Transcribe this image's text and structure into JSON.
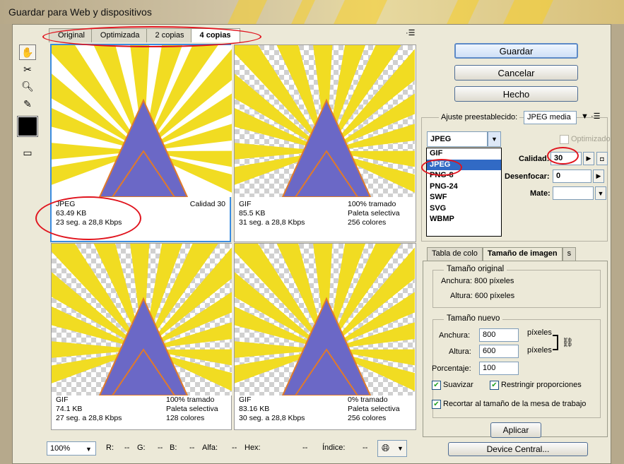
{
  "window": {
    "title": "Guardar para Web y dispositivos"
  },
  "tools": [
    "hand-icon",
    "slice-select-icon",
    "zoom-icon",
    "eyedropper-icon"
  ],
  "view_tabs": [
    {
      "label": "Original",
      "selected": false
    },
    {
      "label": "Optimizada",
      "selected": false
    },
    {
      "label": "2 copias",
      "selected": false
    },
    {
      "label": "4 copias",
      "selected": true
    }
  ],
  "tabs_menu_icon": "menu-icon",
  "panes": [
    {
      "format": "JPEG",
      "size": "63.49 KB",
      "time": "23 seg. a 28,8 Kbps",
      "right1": "Calidad 30",
      "right2": "",
      "right3": ""
    },
    {
      "format": "GIF",
      "size": "85.5 KB",
      "time": "31 seg. a 28,8 Kbps",
      "right1": "100% tramado",
      "right2": "Paleta selectiva",
      "right3": "256 colores"
    },
    {
      "format": "GIF",
      "size": "74.1 KB",
      "time": "27 seg. a 28,8 Kbps",
      "right1": "100% tramado",
      "right2": "Paleta selectiva",
      "right3": "128 colores"
    },
    {
      "format": "GIF",
      "size": "83.16 KB",
      "time": "30 seg. a 28,8 Kbps",
      "right1": "0% tramado",
      "right2": "Paleta selectiva",
      "right3": "256 colores"
    }
  ],
  "buttons": {
    "save": "Guardar",
    "cancel": "Cancelar",
    "done": "Hecho",
    "apply": "Aplicar",
    "device_central": "Device Central..."
  },
  "preset": {
    "label": "Ajuste preestablecido:",
    "value": "JPEG media"
  },
  "format": {
    "value": "JPEG",
    "options": [
      "GIF",
      "JPEG",
      "PNG-8",
      "PNG-24",
      "SWF",
      "SVG",
      "WBMP"
    ],
    "selected_index": 1
  },
  "optimized": {
    "label": "Optimizado",
    "checked": false
  },
  "quality": {
    "label": "Calidad:",
    "value": "30"
  },
  "blur": {
    "label": "Desenfocar:",
    "value": "0"
  },
  "matte": {
    "label": "Mate:",
    "value": ""
  },
  "right_tabs": [
    {
      "label": "Tabla de colo",
      "selected": false
    },
    {
      "label": "Tamaño de imagen",
      "selected": true
    },
    {
      "label": "s",
      "selected": false
    }
  ],
  "original_size": {
    "title": "Tamaño original",
    "width": "Anchura: 800 píxeles",
    "height": "Altura: 600 píxeles"
  },
  "new_size": {
    "title": "Tamaño nuevo",
    "width_label": "Anchura:",
    "width_value": "800",
    "width_unit": "píxeles",
    "height_label": "Altura:",
    "height_value": "600",
    "height_unit": "píxeles",
    "percent_label": "Porcentaje:",
    "percent_value": "100",
    "smooth_label": "Suavizar",
    "smooth_checked": true,
    "constrain_label": "Restringir proporciones",
    "constrain_checked": true,
    "crop_label": "Recortar al tamaño de la mesa de trabajo",
    "crop_checked": true
  },
  "status": {
    "zoom": "100%",
    "r_label": "R:",
    "r_value": "--",
    "g_label": "G:",
    "g_value": "--",
    "b_label": "B:",
    "b_value": "--",
    "alpha_label": "Alfa:",
    "alpha_value": "--",
    "hex_label": "Hex:",
    "hex_value": "--",
    "index_label": "Índice:",
    "index_value": "--"
  },
  "colors": {
    "yellow": "#f1dc22",
    "triangle": "#6b68c6",
    "outline": "#e07a2a",
    "accent_selected": "#3b8ce0",
    "annotation": "#e0141e"
  }
}
